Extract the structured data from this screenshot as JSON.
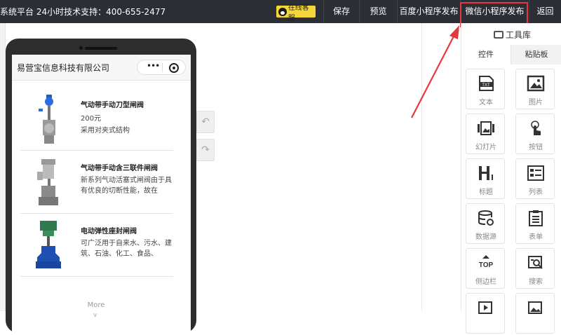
{
  "topbar": {
    "brand_text": "系统平台 24小时技术支持：400-655-2477",
    "customer_service": "在线客服",
    "save": "保存",
    "preview": "预览",
    "baidu_publish": "百度小程序发布",
    "wechat_publish": "微信小程序发布",
    "back": "返回"
  },
  "phone": {
    "site_title": "易营宝信息科技有限公司",
    "capsule_dots": "•••",
    "products": [
      {
        "name": "气动带手动刀型闸阀",
        "price": "200元",
        "desc": "采用对夹式结构"
      },
      {
        "name": "气动带手动含三联件闸阀",
        "desc": "新系列气动活塞式闸阀由于具有优良的切断性能，故在"
      },
      {
        "name": "电动弹性座封闸阀",
        "desc": "可广泛用于自来水、污水、建筑、石油、化工、食品、"
      }
    ],
    "more": "More",
    "chevron": "v"
  },
  "editor": {
    "undo_icon": "↶",
    "redo_icon": "↷"
  },
  "toolbox": {
    "title": "工具库",
    "tabs": [
      "控件",
      "粘贴板"
    ],
    "tools": [
      {
        "label": "文本",
        "icon": "text-icon"
      },
      {
        "label": "图片",
        "icon": "image-icon"
      },
      {
        "label": "幻灯片",
        "icon": "slideshow-icon"
      },
      {
        "label": "按钮",
        "icon": "button-click-icon"
      },
      {
        "label": "标题",
        "icon": "heading-icon"
      },
      {
        "label": "列表",
        "icon": "list-icon"
      },
      {
        "label": "数据源",
        "icon": "database-icon"
      },
      {
        "label": "表单",
        "icon": "form-icon"
      },
      {
        "label": "侧边栏",
        "icon": "sidebar-top-icon"
      },
      {
        "label": "搜索",
        "icon": "search-icon"
      }
    ],
    "txt_badge": "TXT",
    "top_badge": "TOP"
  },
  "colors": {
    "topbar_bg": "#2b2e35",
    "highlight": "#e8383d",
    "cs_button": "#f5d63a"
  }
}
